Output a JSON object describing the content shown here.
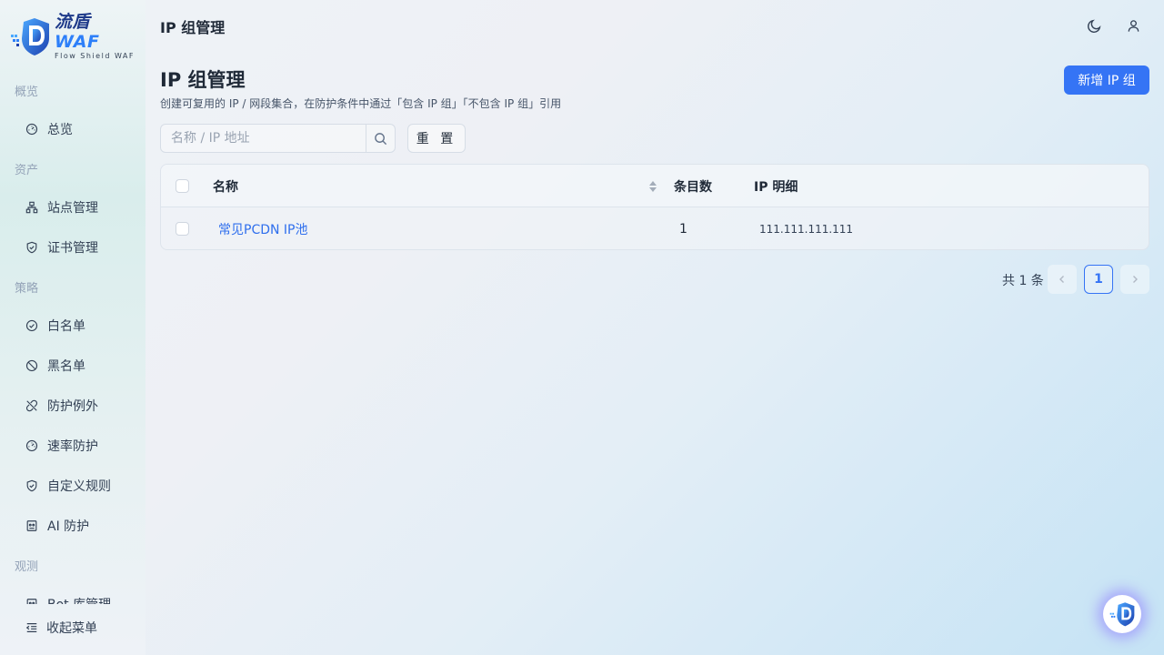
{
  "brand": {
    "name_cn": "流盾",
    "name_waf": "WAF",
    "subtitle": "Flow Shield WAF"
  },
  "header": {
    "title": "IP 组管理"
  },
  "sidebar": {
    "groups": {
      "overview": "概览",
      "assets": "资产",
      "policy": "策略",
      "observe": "观测"
    },
    "items": {
      "dashboard": "总览",
      "sites": "站点管理",
      "certs": "证书管理",
      "whitelist": "白名单",
      "blacklist": "黑名单",
      "exceptions": "防护例外",
      "rate": "速率防护",
      "custom_rules": "自定义规则",
      "ai": "AI 防护",
      "bot": "Bot 库管理"
    },
    "collapse": "收起菜单"
  },
  "main": {
    "title": "IP 组管理",
    "description": "创建可复用的 IP / 网段集合，在防护条件中通过「包含 IP 组」「不包含 IP 组」引用",
    "add_button": "新增 IP 组",
    "search_placeholder": "名称 / IP 地址",
    "reset_button": "重 置"
  },
  "table": {
    "columns": {
      "name": "名称",
      "count": "条目数",
      "detail": "IP 明细"
    },
    "rows": [
      {
        "name": "常见PCDN IP池",
        "count": "1",
        "detail": "111.111.111.111"
      }
    ]
  },
  "pagination": {
    "total": "共 1 条",
    "current": "1"
  },
  "colors": {
    "primary": "#3574f5",
    "link": "#2f6fed"
  }
}
